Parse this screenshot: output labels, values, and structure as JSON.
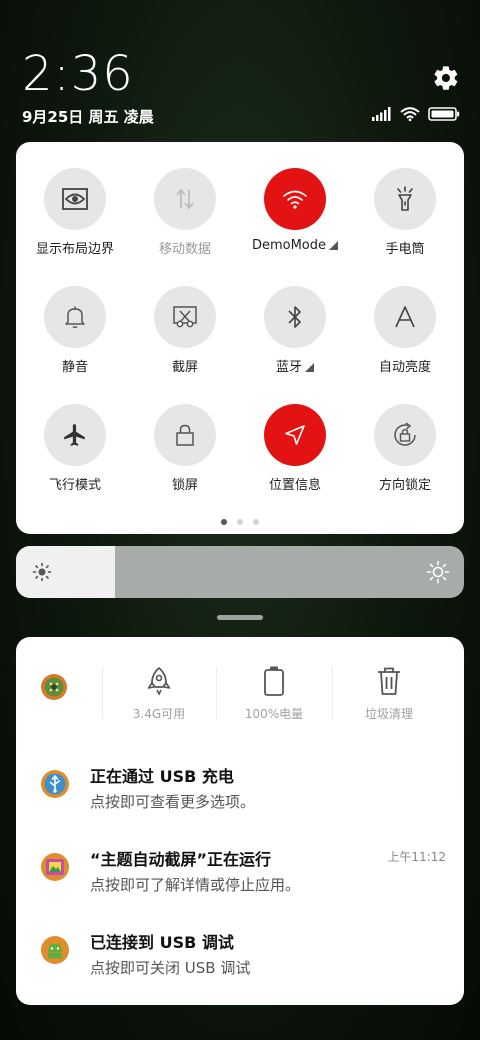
{
  "status": {
    "time": "2:36",
    "date": "9月25日 周五 凌晨"
  },
  "quick_settings": {
    "tiles": [
      {
        "label": "显示布局边界",
        "icon": "eye-frame-icon",
        "active": false,
        "dim": false
      },
      {
        "label": "移动数据",
        "icon": "mobile-data-icon",
        "active": false,
        "dim": true
      },
      {
        "label": "DemoMode",
        "icon": "wifi-icon",
        "active": true,
        "dim": false,
        "expandable": true
      },
      {
        "label": "手电筒",
        "icon": "flashlight-icon",
        "active": false,
        "dim": false
      },
      {
        "label": "静音",
        "icon": "bell-icon",
        "active": false,
        "dim": false
      },
      {
        "label": "截屏",
        "icon": "screenshot-icon",
        "active": false,
        "dim": false
      },
      {
        "label": "蓝牙",
        "icon": "bluetooth-icon",
        "active": false,
        "dim": false,
        "expandable": true
      },
      {
        "label": "自动亮度",
        "icon": "auto-brightness-icon",
        "active": false,
        "dim": false
      },
      {
        "label": "飞行模式",
        "icon": "airplane-icon",
        "active": false,
        "dim": false
      },
      {
        "label": "锁屏",
        "icon": "lock-icon",
        "active": false,
        "dim": false
      },
      {
        "label": "位置信息",
        "icon": "location-icon",
        "active": true,
        "dim": false
      },
      {
        "label": "方向锁定",
        "icon": "rotation-lock-icon",
        "active": false,
        "dim": false
      }
    ],
    "page_count": 3,
    "current_page": 1
  },
  "brightness": {
    "level": 0.22
  },
  "colors": {
    "accent_red": "#e41313",
    "panel_bg": "#ffffff",
    "tile_bg": "#e6e6e6"
  },
  "notifications": {
    "tools": [
      {
        "label": "3.4G可用",
        "icon": "rocket-icon"
      },
      {
        "label": "100%电量",
        "icon": "battery-icon"
      },
      {
        "label": "垃圾清理",
        "icon": "trash-icon"
      }
    ],
    "items": [
      {
        "title": "正在通过 USB 充电",
        "subtitle": "点按即可查看更多选项。",
        "time": ""
      },
      {
        "title": "“主题自动截屏”正在运行",
        "subtitle": "点按即可了解详情或停止应用。",
        "time": "上午11:12"
      },
      {
        "title": "已连接到 USB 调试",
        "subtitle": "点按即可关闭 USB 调试",
        "time": ""
      }
    ]
  }
}
